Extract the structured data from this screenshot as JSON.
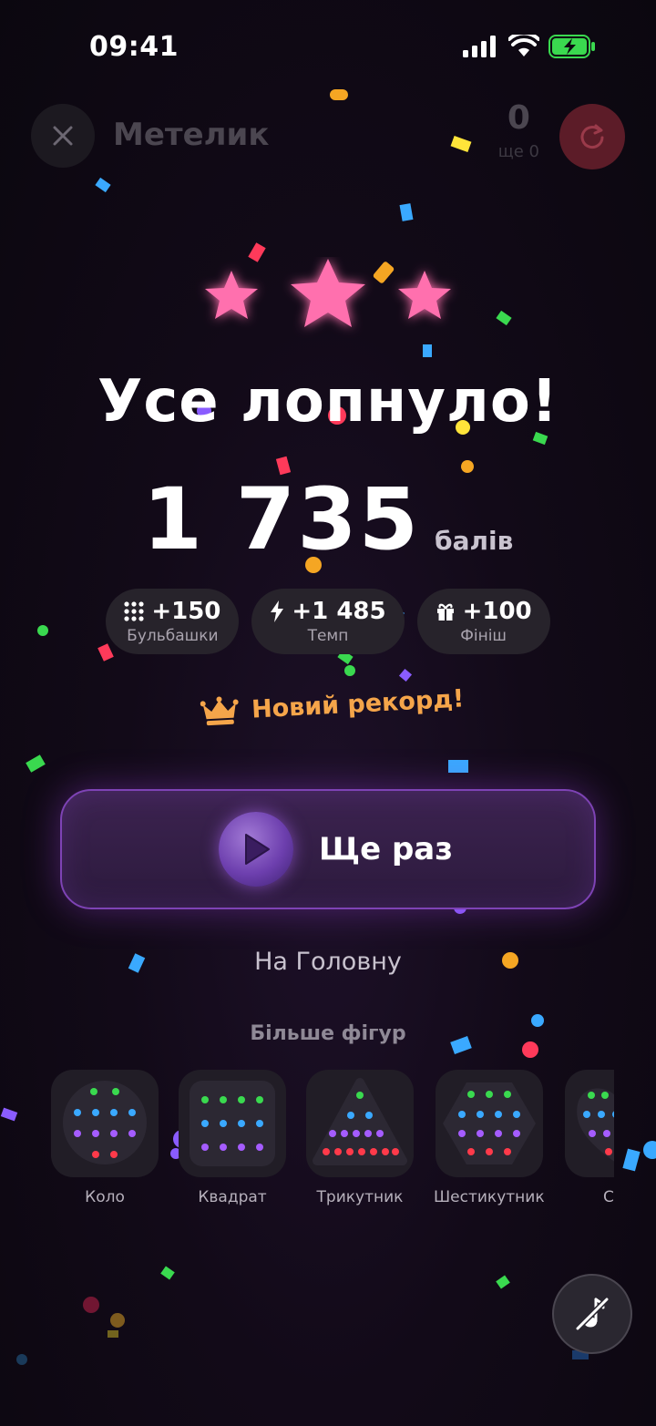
{
  "status": {
    "time": "09:41"
  },
  "header": {
    "title": "Метелик",
    "score": "0",
    "score_sub": "ще 0"
  },
  "result": {
    "headline": "Усе лопнуло!",
    "score": "1 735",
    "score_unit": "балів",
    "stars_earned": 3,
    "bonuses": [
      {
        "icon": "grid-dots-icon",
        "value": "+150",
        "label": "Бульбашки"
      },
      {
        "icon": "lightning-icon",
        "value": "+1 485",
        "label": "Темп"
      },
      {
        "icon": "gift-icon",
        "value": "+100",
        "label": "Фініш"
      }
    ],
    "record_text": "Новий рекорд!"
  },
  "actions": {
    "again_label": "Ще раз",
    "home_label": "На Головну"
  },
  "more": {
    "title": "Більше фігур",
    "shapes": [
      {
        "label": "Коло"
      },
      {
        "label": "Квадрат"
      },
      {
        "label": "Трикутник"
      },
      {
        "label": "Шестикутник"
      },
      {
        "label": "Сер"
      }
    ]
  },
  "colors": {
    "accent": "#7e43b5",
    "star": "#ff6fae",
    "record": "#f5a54a",
    "restart": "#5c1c28"
  }
}
